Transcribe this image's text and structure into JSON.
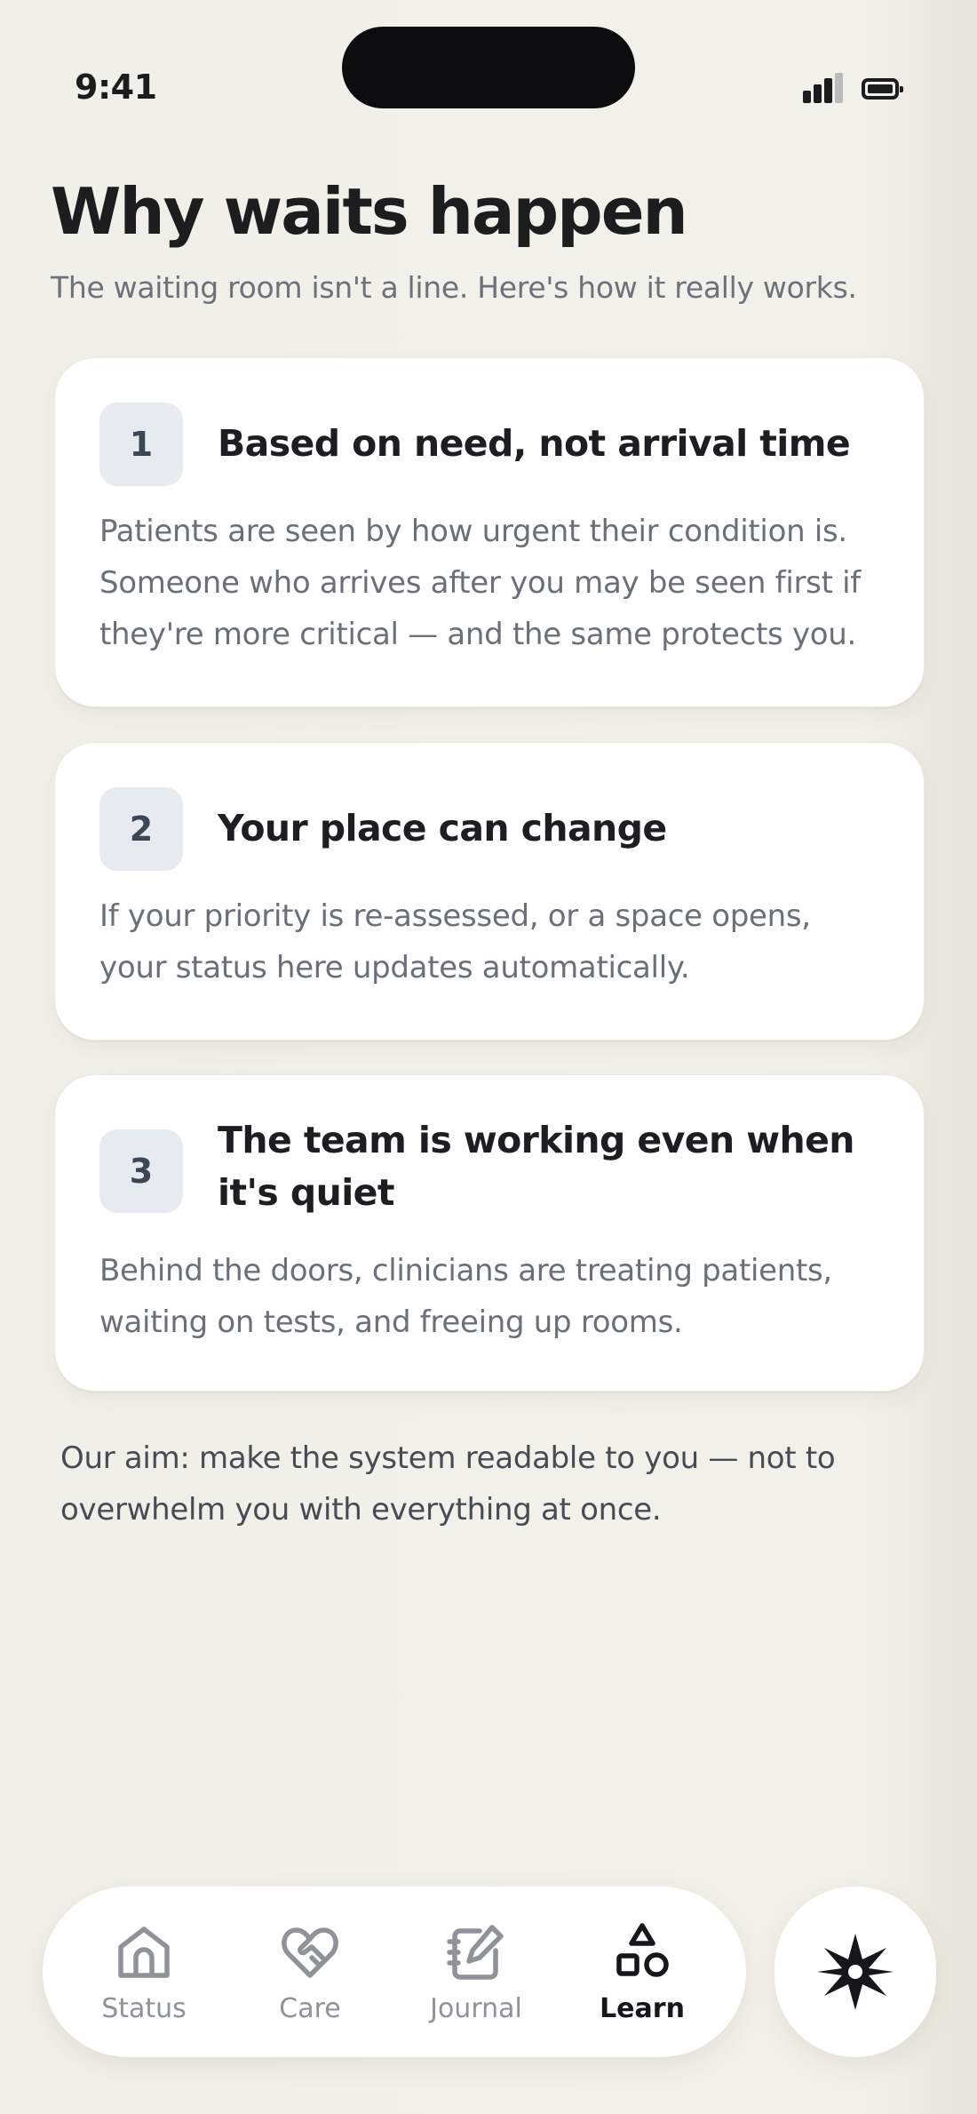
{
  "status_bar": {
    "time": "9:41"
  },
  "header": {
    "title": "Why waits happen",
    "subtitle": "The waiting room isn't a line. Here's how it really works."
  },
  "cards": [
    {
      "number": "1",
      "title": "Based on need, not arrival time",
      "body": "Patients are seen by how urgent their condition is. Someone who arrives after you may be seen first if they're more critical — and the same protects you."
    },
    {
      "number": "2",
      "title": "Your place can change",
      "body": "If your priority is re-assessed, or a space opens, your status here updates automatically."
    },
    {
      "number": "3",
      "title": "The team is working even when it's quiet",
      "body": "Behind the doors, clinicians are treating patients, waiting on tests, and freeing up rooms."
    }
  ],
  "footer_note": "Our aim: make the system readable to you — not to overwhelm you with everything at once.",
  "nav": {
    "tabs": [
      {
        "label": "Status",
        "icon": "home-icon"
      },
      {
        "label": "Care",
        "icon": "heart-handshake-icon"
      },
      {
        "label": "Journal",
        "icon": "notebook-pen-icon"
      },
      {
        "label": "Learn",
        "icon": "shapes-icon",
        "active": true
      }
    ],
    "action_icon": "sparkle-compass-icon"
  },
  "colors": {
    "background": "#f1efe9",
    "card": "#ffffff",
    "badge": "#e7eaee",
    "muted_text": "#6b6f78"
  }
}
